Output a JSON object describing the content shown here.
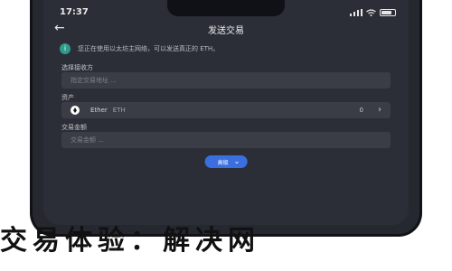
{
  "status_bar": {
    "time": "17:37"
  },
  "header": {
    "title": "发送交易"
  },
  "notice": {
    "text": "您正在使用以太坊主网络，可以发送真正的 ETH。"
  },
  "recipient": {
    "label": "选择接收方",
    "placeholder": "指定交易地址 ..."
  },
  "asset": {
    "label": "资产",
    "name": "Ether",
    "symbol": "ETH",
    "balance": "0"
  },
  "amount": {
    "label": "交易金额",
    "placeholder": "交易金额 ..."
  },
  "advanced": {
    "label": "高级"
  },
  "banner": {
    "text": "交易体验：解决网"
  },
  "colors": {
    "phone_bg": "#2b2e36",
    "accent": "#3b6fe0",
    "notice_icon": "#2f9a8e"
  }
}
